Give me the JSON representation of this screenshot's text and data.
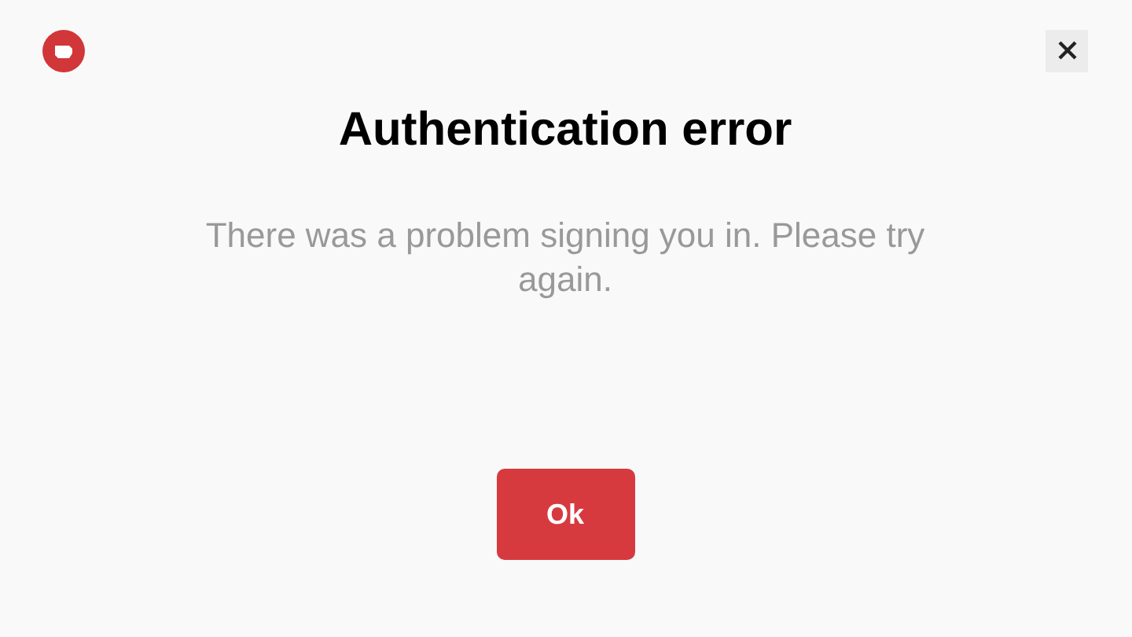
{
  "dialog": {
    "title": "Authentication error",
    "message": "There was a problem signing you in. Please try again.",
    "button": "Ok"
  }
}
